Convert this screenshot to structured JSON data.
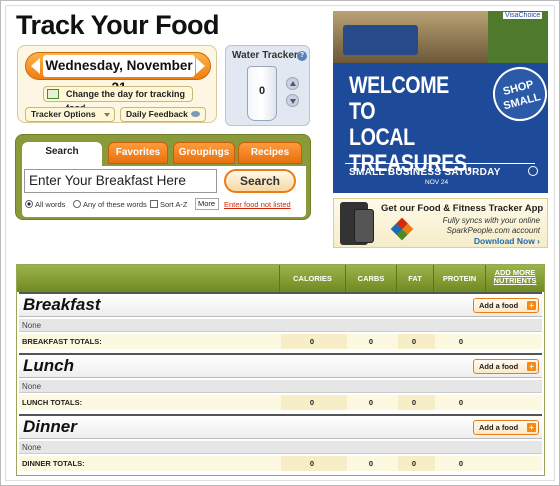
{
  "page": {
    "title": "Track Your Food"
  },
  "date_panel": {
    "current_date": "Wednesday, November 21",
    "change_day_label": "Change the day for tracking food",
    "tracker_options_label": "Tracker Options",
    "daily_feedback_label": "Daily Feedback"
  },
  "water_tracker": {
    "title": "Water Tracker",
    "help": "?",
    "count": "0"
  },
  "search": {
    "tabs": [
      {
        "label": "Search",
        "active": true
      },
      {
        "label": "Favorites"
      },
      {
        "label": "Groupings"
      },
      {
        "label": "Recipes"
      }
    ],
    "input_value": "Enter Your Breakfast Here",
    "button_label": "Search",
    "options": {
      "all_words": "All words",
      "any_words": "Any of these words",
      "sort": "Sort A-Z",
      "more": "More"
    },
    "food_not_listed": "Enter food not listed"
  },
  "ad": {
    "badge": "VisaChoice",
    "headline_line1": "WELCOME TO",
    "headline_line2": "LOCAL TREASURES.",
    "shop_small_line1": "SHOP",
    "shop_small_line2": "SMALL",
    "event": "SMALL BUSINESS SATURDAY",
    "event_date": "NOV 24",
    "colors": {
      "background": "#1e4a9a"
    }
  },
  "app_ad": {
    "headline": "Get our Food & Fitness Tracker App",
    "line1": "Fully syncs with your online",
    "line2": "SparkPeople.com account",
    "download": "Download Now ›"
  },
  "log": {
    "columns": [
      "CALORIES",
      "CARBS",
      "FAT",
      "PROTEIN"
    ],
    "add_more_line1": "ADD MORE",
    "add_more_line2": "NUTRIENTS",
    "add_food_label": "Add a food",
    "meals": [
      {
        "name": "Breakfast",
        "empty": "None",
        "totals_label": "BREAKFAST TOTALS:",
        "totals": [
          "0",
          "0",
          "0",
          "0"
        ]
      },
      {
        "name": "Lunch",
        "empty": "None",
        "totals_label": "LUNCH TOTALS:",
        "totals": [
          "0",
          "0",
          "0",
          "0"
        ]
      },
      {
        "name": "Dinner",
        "empty": "None",
        "totals_label": "DINNER TOTALS:",
        "totals": [
          "0",
          "0",
          "0",
          "0"
        ]
      }
    ]
  },
  "colors": {
    "accent_orange": "#f07d12",
    "header_green": "#7f9a30",
    "link_red": "#d42a0a"
  }
}
